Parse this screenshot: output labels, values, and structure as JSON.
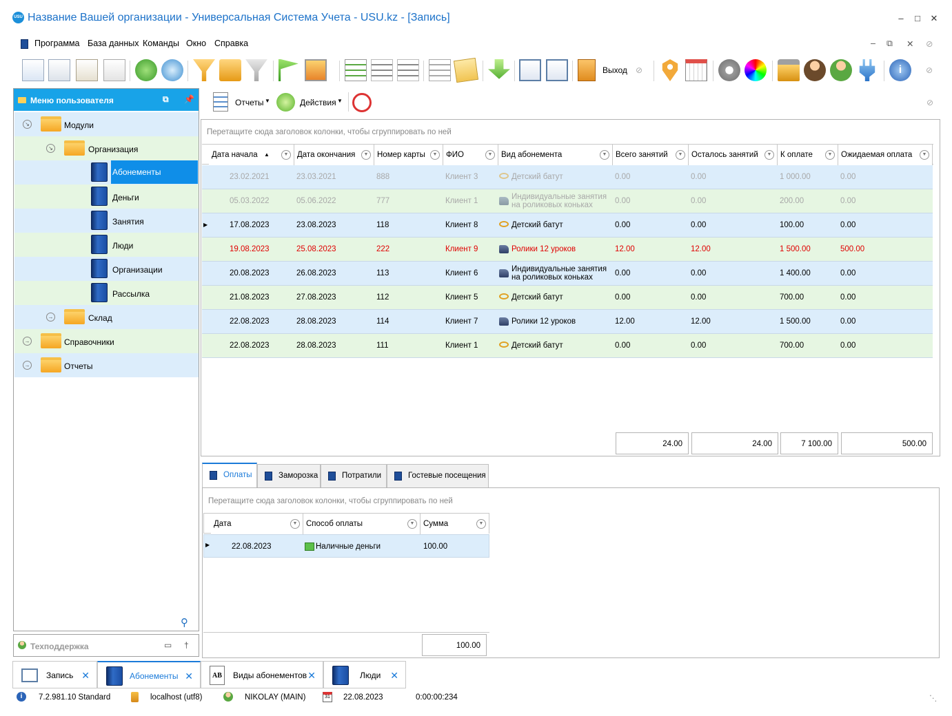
{
  "window": {
    "title": "Название Вашей организации - Универсальная Система Учета - USU.kz - [Запись]",
    "logo": "USU"
  },
  "menu": [
    "Программа",
    "База данных",
    "Команды",
    "Окно",
    "Справка"
  ],
  "toolbar": {
    "exit_label": "Выход"
  },
  "left_panel": {
    "title": "Меню пользователя",
    "tree": {
      "modules": "Модули",
      "organization": "Организация",
      "items": [
        "Абонементы",
        "Деньги",
        "Занятия",
        "Люди",
        "Организации",
        "Рассылка"
      ],
      "warehouse": "Склад",
      "references": "Справочники",
      "reports": "Отчеты"
    },
    "support": "Техподдержка"
  },
  "subtoolbar": {
    "reports": "Отчеты",
    "actions": "Действия"
  },
  "main_grid": {
    "group_hint": "Перетащите сюда заголовок колонки, чтобы сгруппировать по ней",
    "columns": [
      "Дата начала",
      "Дата окончания",
      "Номер карты",
      "ФИО",
      "Вид абонемента",
      "Всего занятий",
      "Осталось занятий",
      "К оплате",
      "Ожидаемая оплата"
    ],
    "rows": [
      {
        "start": "23.02.2021",
        "end": "23.03.2021",
        "card": "888",
        "name": "Клиент 3",
        "type": "Детский батут",
        "total": "0.00",
        "left": "0.00",
        "pay": "1 000.00",
        "expected": "0.00",
        "style": "dim",
        "bg": "b",
        "icon": "trampoline-icon"
      },
      {
        "start": "05.03.2022",
        "end": "05.06.2022",
        "card": "777",
        "name": "Клиент 1",
        "type": "Индивидуальные занятия на роликовых коньках",
        "total": "0.00",
        "left": "0.00",
        "pay": "200.00",
        "expected": "0.00",
        "style": "dim",
        "bg": "g",
        "icon": "roller-skate-icon"
      },
      {
        "start": "17.08.2023",
        "end": "23.08.2023",
        "card": "118",
        "name": "Клиент 8",
        "type": "Детский батут",
        "total": "0.00",
        "left": "0.00",
        "pay": "100.00",
        "expected": "0.00",
        "style": "",
        "bg": "b",
        "icon": "trampoline-icon"
      },
      {
        "start": "19.08.2023",
        "end": "25.08.2023",
        "card": "222",
        "name": "Клиент 9",
        "type": "Ролики 12 уроков",
        "total": "12.00",
        "left": "12.00",
        "pay": "1 500.00",
        "expected": "500.00",
        "style": "red",
        "bg": "g",
        "icon": "roller-skate-icon"
      },
      {
        "start": "20.08.2023",
        "end": "26.08.2023",
        "card": "113",
        "name": "Клиент 6",
        "type": "Индивидуальные занятия на роликовых коньках",
        "total": "0.00",
        "left": "0.00",
        "pay": "1 400.00",
        "expected": "0.00",
        "style": "",
        "bg": "b",
        "icon": "roller-skate-icon"
      },
      {
        "start": "21.08.2023",
        "end": "27.08.2023",
        "card": "112",
        "name": "Клиент 5",
        "type": "Детский батут",
        "total": "0.00",
        "left": "0.00",
        "pay": "700.00",
        "expected": "0.00",
        "style": "",
        "bg": "g",
        "icon": "trampoline-icon"
      },
      {
        "start": "22.08.2023",
        "end": "28.08.2023",
        "card": "114",
        "name": "Клиент 7",
        "type": "Ролики 12 уроков",
        "total": "12.00",
        "left": "12.00",
        "pay": "1 500.00",
        "expected": "0.00",
        "style": "",
        "bg": "b",
        "icon": "roller-skate-icon"
      },
      {
        "start": "22.08.2023",
        "end": "28.08.2023",
        "card": "111",
        "name": "Клиент 1",
        "type": "Детский батут",
        "total": "0.00",
        "left": "0.00",
        "pay": "700.00",
        "expected": "0.00",
        "style": "",
        "bg": "g",
        "icon": "trampoline-icon"
      }
    ],
    "totals": {
      "total": "24.00",
      "left": "24.00",
      "pay": "7 100.00",
      "expected": "500.00"
    }
  },
  "detail_tabs": [
    "Оплаты",
    "Заморозка",
    "Потратили",
    "Гостевые посещения"
  ],
  "detail_grid": {
    "group_hint": "Перетащите сюда заголовок колонки, чтобы сгруппировать по ней",
    "columns": [
      "Дата",
      "Способ оплаты",
      "Сумма"
    ],
    "rows": [
      {
        "date": "22.08.2023",
        "method": "Наличные деньги",
        "sum": "100.00"
      }
    ],
    "total": "100.00"
  },
  "doc_tabs": [
    "Запись",
    "Абонементы",
    "Виды абонементов",
    "Люди"
  ],
  "status": {
    "version": "7.2.981.10 Standard",
    "db": "localhost (utf8)",
    "user": "NIKOLAY (MAIN)",
    "date": "22.08.2023",
    "timer": "0:00:00:234"
  }
}
